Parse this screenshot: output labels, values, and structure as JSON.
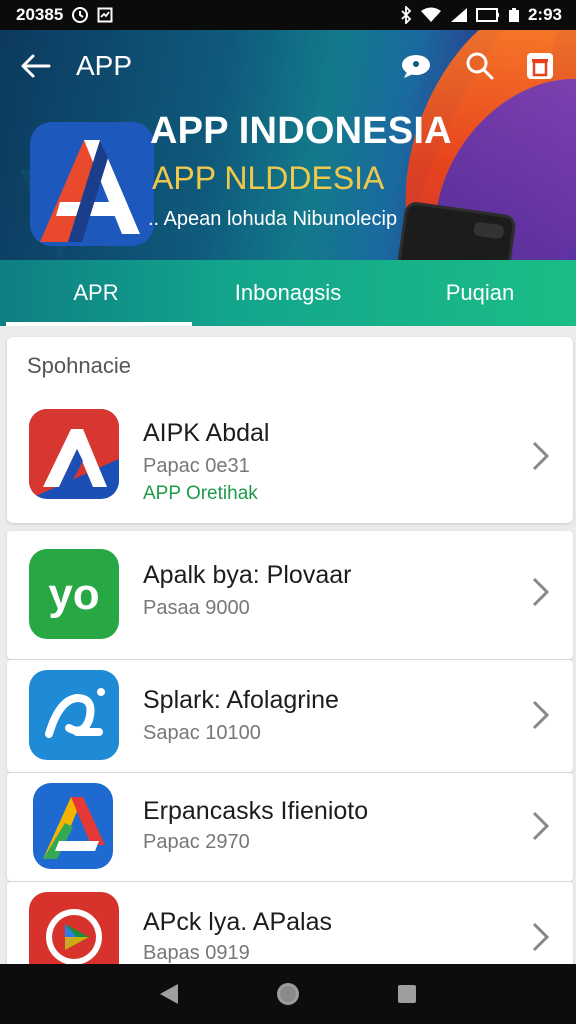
{
  "status_bar": {
    "time_left": "20385",
    "time_right": "2:93"
  },
  "app_bar": {
    "title": "APP"
  },
  "hero": {
    "title": "APP INDONESIA",
    "subtitle": "APP NLDDESIA",
    "tagline": ".. Apean lohuda Nibunolecip"
  },
  "tabs": [
    {
      "label": "APR",
      "active": true
    },
    {
      "label": "Inbonagsis",
      "active": false
    },
    {
      "label": "Puqian",
      "active": false
    }
  ],
  "section": {
    "label": "Spohnacie"
  },
  "items": [
    {
      "title": "AIPK Abdal",
      "subtitle": "Papac 0e31",
      "status": "APP Oretihak",
      "icon": "app-a-red-blue-icon"
    },
    {
      "title": "Apalk bya: Plovaar",
      "subtitle": "Pasaa 9000",
      "status": "",
      "icon": "yo-green-icon"
    },
    {
      "title": "Splark: Afolagrine",
      "subtitle": "Sapac 10100",
      "status": "",
      "icon": "blue-swirl-icon"
    },
    {
      "title": "Erpancasks Ifienioto",
      "subtitle": "Papac 2970",
      "status": "",
      "icon": "colorful-a-icon"
    },
    {
      "title": "APck lya. APalas",
      "subtitle": "Bapas 0919",
      "status": "",
      "icon": "red-play-icon"
    }
  ],
  "colors": {
    "accent_green": "#1f9a4a",
    "tab_start": "#0f7e84",
    "tab_end": "#1bbd86",
    "hero_title_secondary": "#f2c84a"
  }
}
